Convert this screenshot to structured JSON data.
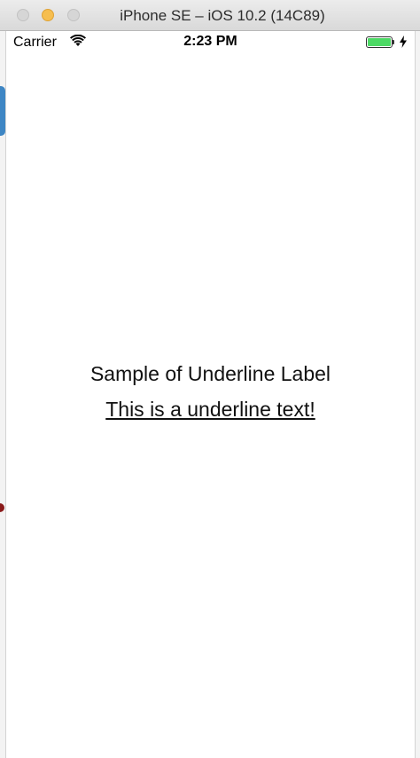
{
  "window": {
    "title": "iPhone SE – iOS 10.2 (14C89)"
  },
  "status_bar": {
    "carrier": "Carrier",
    "time": "2:23 PM",
    "battery_level": 1.0,
    "icons": [
      "wifi-icon",
      "battery-icon",
      "charging-bolt-icon"
    ]
  },
  "screen": {
    "title_label": "Sample of Underline Label",
    "underline_label": "This is a underline text!"
  },
  "colors": {
    "battery_green": "#4cd964",
    "minimize_yellow": "#f6be4f"
  }
}
